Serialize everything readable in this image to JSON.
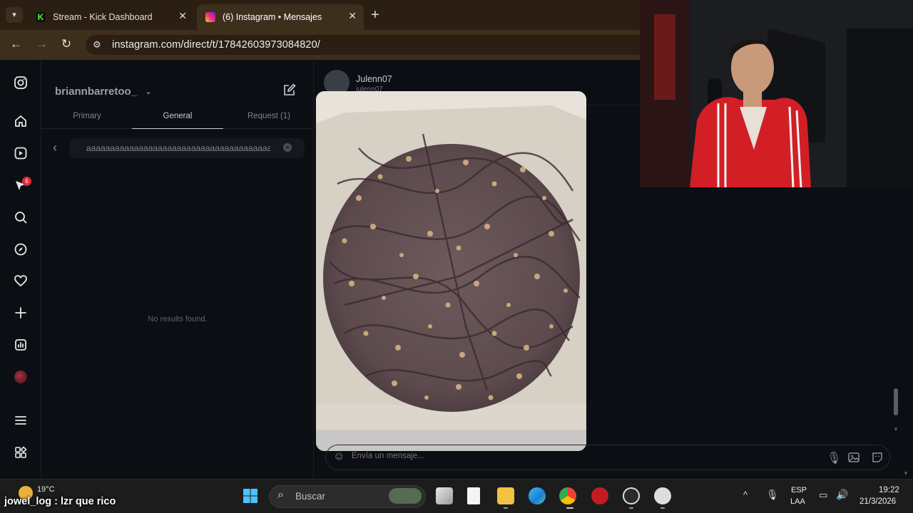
{
  "browser": {
    "tabs": [
      {
        "title": "Stream - Kick Dashboard",
        "close": "✕",
        "favicon_color": "#53fc18"
      },
      {
        "title": "(6) Instagram • Mensajes",
        "close": "✕",
        "favicon_color": "#d62976"
      }
    ],
    "new_tab": "+",
    "url": "instagram.com/direct/t/17842603973084820/"
  },
  "instagram": {
    "badge_count": "6",
    "username": "briannbarretoo_",
    "inbox_tabs": [
      "Primary",
      "General",
      "Request (1)"
    ],
    "active_tab": "General",
    "search_value": "aaaaaaaaaaaaaaaaaaaaaaaaaaaaaaaaaaaaaaaaaaaaaaaa",
    "no_results": "No results found.",
    "chat": {
      "name": "Julenn07",
      "handle": "julenn07"
    },
    "message_placeholder": "Envía un mensaje..."
  },
  "overlay": {
    "chat_message": "jowel_log : lzr que rico"
  },
  "taskbar": {
    "weather_temp": "19°C",
    "search_placeholder": "Buscar",
    "lang_line1": "ESP",
    "lang_line2": "LAA",
    "time": "19:22",
    "date": "21/3/2026"
  },
  "colors": {
    "ig_background": "#0b0e13",
    "browser_frame": "#3e2f1c",
    "taskbar": "#1c1c1c"
  }
}
